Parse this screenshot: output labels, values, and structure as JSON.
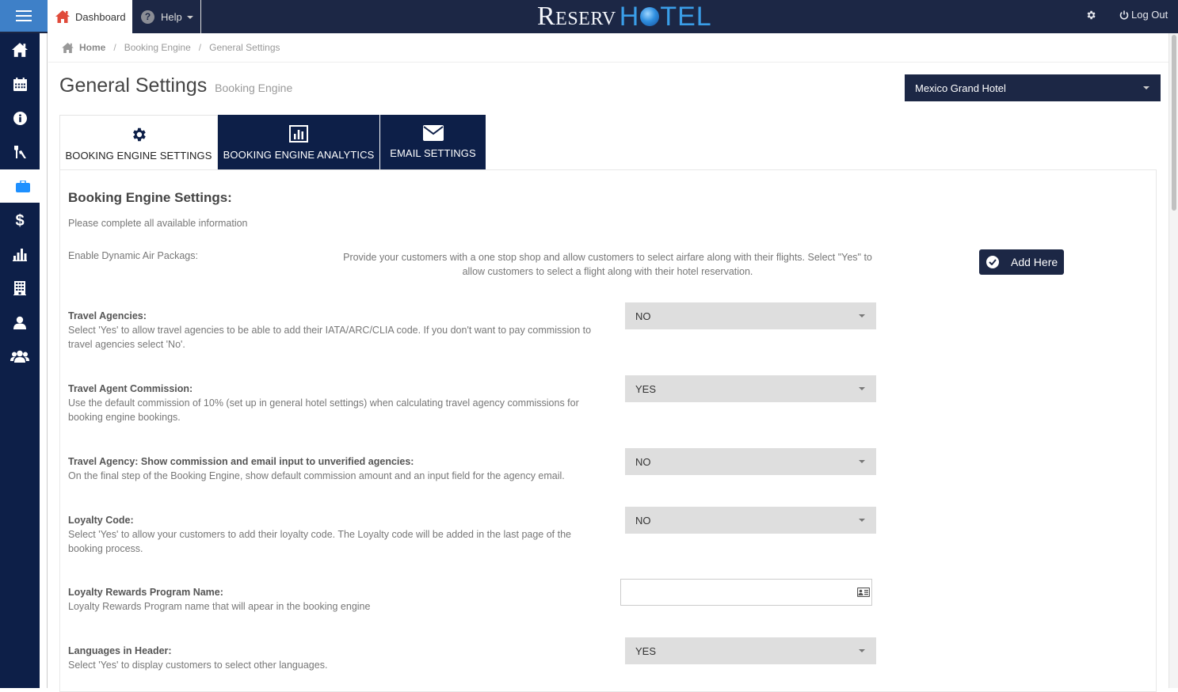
{
  "topbar": {
    "dashboard_label": "Dashboard",
    "help_label": "Help",
    "logo_part1": "Reserv",
    "logo_part2_a": "H",
    "logo_part2_b": "TEL",
    "logout_label": "Log Out"
  },
  "sidebar": {
    "items": [
      {
        "icon": "home-icon",
        "active": false
      },
      {
        "icon": "calendar-icon",
        "active": false
      },
      {
        "icon": "info-icon",
        "active": false
      },
      {
        "icon": "keys-icon",
        "active": false
      },
      {
        "icon": "briefcase-icon",
        "active": true
      },
      {
        "icon": "dollar-icon",
        "active": false
      },
      {
        "icon": "bar-chart-icon",
        "active": false
      },
      {
        "icon": "building-icon",
        "active": false
      },
      {
        "icon": "user-icon",
        "active": false
      },
      {
        "icon": "users-icon",
        "active": false
      }
    ]
  },
  "breadcrumb": {
    "home": "Home",
    "items": [
      "Booking Engine",
      "General Settings"
    ]
  },
  "page": {
    "title": "General Settings",
    "subtitle": "Booking Engine",
    "hotel_selected": "Mexico Grand Hotel"
  },
  "tabs": [
    {
      "label": "BOOKING ENGINE SETTINGS",
      "icon": "gear-icon",
      "active": true
    },
    {
      "label": "BOOKING ENGINE ANALYTICS",
      "icon": "bar-chart-icon",
      "active": false
    },
    {
      "label": "EMAIL SETTINGS",
      "icon": "envelope-icon",
      "active": false
    }
  ],
  "settings": {
    "title": "Booking Engine Settings:",
    "note": "Please complete all available information",
    "air": {
      "label": "Enable Dynamic Air Packags:",
      "description": "Provide your customers with a one stop shop and allow customers to select airfare along with their flights. Select \"Yes\" to allow customers to select a flight along with their hotel reservation.",
      "button": "Add Here"
    },
    "rows": [
      {
        "title": "Travel Agencies:",
        "description": "Select 'Yes' to allow travel agencies to be able to add their IATA/ARC/CLIA code. If you don't want to pay commission to travel agencies select 'No'.",
        "value": "NO"
      },
      {
        "title": "Travel Agent Commission:",
        "description": "Use the default commission of 10% (set up in general hotel settings) when calculating travel agency commissions for booking engine bookings.",
        "value": "YES"
      },
      {
        "title": "Travel Agency: Show commission and email input to unverified agencies:",
        "description": "On the final step of the Booking Engine, show default commission amount and an input field for the agency email.",
        "value": "NO"
      },
      {
        "title": "Loyalty Code:",
        "description": "Select 'Yes' to allow your customers to add their loyalty code. The Loyalty code will be added in the last page of the booking process.",
        "value": "NO"
      },
      {
        "title": "Loyalty Rewards Program Name:",
        "description": "Loyalty Rewards Program name that will apear in the booking engine",
        "value": ""
      },
      {
        "title": "Languages in Header:",
        "description": "Select 'Yes' to display customers to select other languages.",
        "value": "YES"
      }
    ]
  },
  "colors": {
    "navy": "#1c2745",
    "sidebar": "#0d1f48",
    "accent_blue": "#3e80c8",
    "active_icon": "#1e90ff",
    "dashboard_icon": "#e04a3a"
  }
}
